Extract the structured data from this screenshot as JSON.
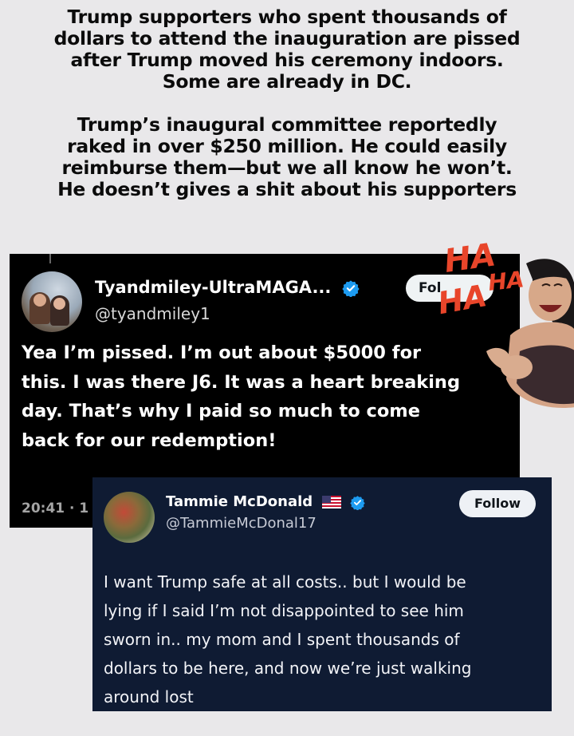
{
  "headline": {
    "para1": [
      "Trump supporters who spent thousands of",
      "dollars to attend the inauguration are pissed",
      "after Trump moved his ceremony indoors.",
      "Some are already in DC."
    ],
    "para2": [
      "Trump’s inaugural committee reportedly",
      "raked in over $250 million. He could easily",
      "reimburse them—but we all know he won’t.",
      "He doesn’t gives a shit about his supporters"
    ]
  },
  "tweet1": {
    "display_name": "Tyandmiley-UltraMAGA...",
    "handle": "@tyandmiley1",
    "follow_label": "Fol",
    "body_lines": [
      "Yea I’m pissed. I’m out about $5000 for",
      "this.  I was there J6. It was a heart breaking",
      "day. That’s why I paid so much to come",
      "back for our redemption!"
    ],
    "timestamp": "20:41 · 1",
    "avatar_icon": "couple-photo-avatar",
    "verified_icon": "verified-badge-icon"
  },
  "sticker": {
    "text_1": "HA",
    "text_2": "HA",
    "text_3": "HA",
    "text_color": "#e8452a",
    "icon": "laughing-woman-sticker"
  },
  "tweet2": {
    "display_name": "Tammie McDonald",
    "handle": "@TammieMcDonal17",
    "follow_label": "Follow",
    "body_lines": [
      "I want Trump safe at all costs.. but I would be",
      "lying if I said I’m not disappointed to see him",
      "sworn in.. my mom and I spent thousands of",
      "dollars to be here, and now we’re just walking",
      "around lost"
    ],
    "avatar_icon": "flowers-avatar",
    "flag_icon": "us-flag-icon",
    "verified_icon": "verified-badge-icon"
  },
  "colors": {
    "background": "#e9e8ea",
    "tweet1_bg": "#000000",
    "tweet2_bg": "#0f1b33",
    "verified_blue": "#1d9bf0"
  }
}
